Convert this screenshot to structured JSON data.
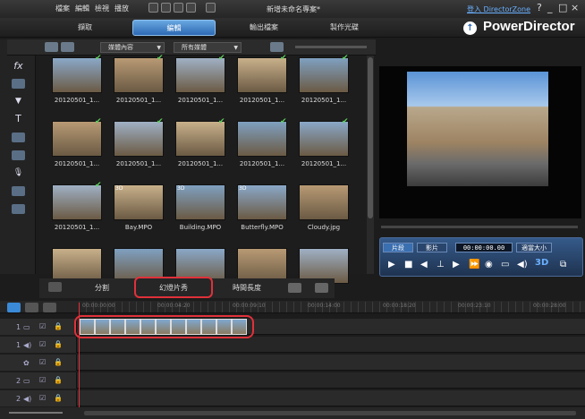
{
  "menu": [
    "檔案",
    "編輯",
    "檢視",
    "播放"
  ],
  "project_title": "新增未命名專案*",
  "login_link": "登入 DirectorZone",
  "window_controls": [
    "?",
    "_",
    "□",
    "×"
  ],
  "modes": {
    "capture": "擷取",
    "edit": "編輯",
    "output": "輸出檔案",
    "disc": "製作光碟"
  },
  "brand": "PowerDirector",
  "library": {
    "filter_1": "媒體內容",
    "filter_2": "所有媒體",
    "items": [
      {
        "caption": "20120501_1...",
        "checked": true
      },
      {
        "caption": "20120501_1...",
        "checked": true
      },
      {
        "caption": "20120501_1...",
        "checked": true
      },
      {
        "caption": "20120501_1...",
        "checked": true
      },
      {
        "caption": "20120501_1...",
        "checked": true
      },
      {
        "caption": "20120501_1...",
        "checked": true
      },
      {
        "caption": "20120501_1...",
        "checked": true
      },
      {
        "caption": "20120501_1...",
        "checked": true
      },
      {
        "caption": "20120501_1...",
        "checked": true
      },
      {
        "caption": "20120501_1...",
        "checked": true
      },
      {
        "caption": "20120501_1...",
        "checked": true
      },
      {
        "caption": "Bay.MPO",
        "checked": false,
        "badge": "3D"
      },
      {
        "caption": "Building.MPO",
        "checked": false,
        "badge": "3D"
      },
      {
        "caption": "Butterfly.MPO",
        "checked": false,
        "badge": "3D"
      },
      {
        "caption": "Cloudy.jpg",
        "checked": false
      },
      {
        "caption": "",
        "checked": false
      },
      {
        "caption": "",
        "checked": false
      },
      {
        "caption": "",
        "checked": false
      },
      {
        "caption": "",
        "checked": false
      },
      {
        "caption": "",
        "checked": false
      }
    ]
  },
  "player": {
    "mode_clip": "片段",
    "mode_movie": "影片",
    "timecode": "00:00:00.00",
    "zoom": "適當大小",
    "three_d": "3D"
  },
  "function_bar": {
    "split": "分割",
    "slideshow": "幻燈片秀",
    "duration": "時間長度"
  },
  "ruler_ticks": [
    "00:00:00:00",
    "00:00:04:20",
    "00:00:09:10",
    "00:00:14:00",
    "00:00:18:20",
    "00:00:23:10",
    "00:00:28:00"
  ],
  "tracks": [
    "1",
    "1",
    "",
    "2",
    "2"
  ],
  "colors": {
    "accent": "#2c69b4",
    "highlight": "#e0313a",
    "checkmark": "#5fd35f"
  }
}
